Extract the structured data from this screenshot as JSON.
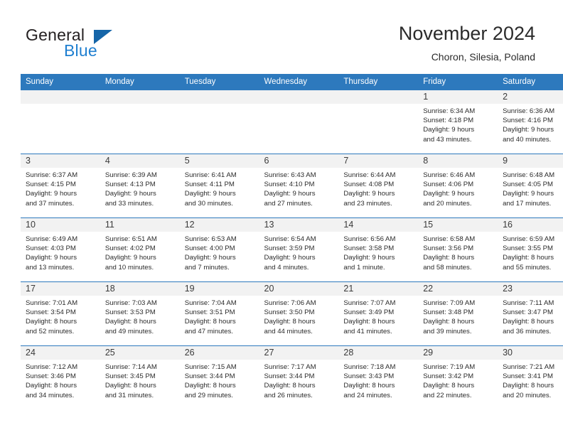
{
  "brand": {
    "name_part1": "General",
    "name_part2": "Blue",
    "triangle_color": "#1565a8",
    "blue_color": "#1f7fd0"
  },
  "header": {
    "month_title": "November 2024",
    "location": "Choron, Silesia, Poland"
  },
  "theme": {
    "header_blue": "#2d79bd",
    "daynum_band": "#f2f2f2",
    "text": "#2b2b2b"
  },
  "weekdays": [
    "Sunday",
    "Monday",
    "Tuesday",
    "Wednesday",
    "Thursday",
    "Friday",
    "Saturday"
  ],
  "weeks": [
    [
      {
        "day": "",
        "sunrise": "",
        "sunset": "",
        "daylight_line1": "",
        "daylight_line2": ""
      },
      {
        "day": "",
        "sunrise": "",
        "sunset": "",
        "daylight_line1": "",
        "daylight_line2": ""
      },
      {
        "day": "",
        "sunrise": "",
        "sunset": "",
        "daylight_line1": "",
        "daylight_line2": ""
      },
      {
        "day": "",
        "sunrise": "",
        "sunset": "",
        "daylight_line1": "",
        "daylight_line2": ""
      },
      {
        "day": "",
        "sunrise": "",
        "sunset": "",
        "daylight_line1": "",
        "daylight_line2": ""
      },
      {
        "day": "1",
        "sunrise": "Sunrise: 6:34 AM",
        "sunset": "Sunset: 4:18 PM",
        "daylight_line1": "Daylight: 9 hours",
        "daylight_line2": "and 43 minutes."
      },
      {
        "day": "2",
        "sunrise": "Sunrise: 6:36 AM",
        "sunset": "Sunset: 4:16 PM",
        "daylight_line1": "Daylight: 9 hours",
        "daylight_line2": "and 40 minutes."
      }
    ],
    [
      {
        "day": "3",
        "sunrise": "Sunrise: 6:37 AM",
        "sunset": "Sunset: 4:15 PM",
        "daylight_line1": "Daylight: 9 hours",
        "daylight_line2": "and 37 minutes."
      },
      {
        "day": "4",
        "sunrise": "Sunrise: 6:39 AM",
        "sunset": "Sunset: 4:13 PM",
        "daylight_line1": "Daylight: 9 hours",
        "daylight_line2": "and 33 minutes."
      },
      {
        "day": "5",
        "sunrise": "Sunrise: 6:41 AM",
        "sunset": "Sunset: 4:11 PM",
        "daylight_line1": "Daylight: 9 hours",
        "daylight_line2": "and 30 minutes."
      },
      {
        "day": "6",
        "sunrise": "Sunrise: 6:43 AM",
        "sunset": "Sunset: 4:10 PM",
        "daylight_line1": "Daylight: 9 hours",
        "daylight_line2": "and 27 minutes."
      },
      {
        "day": "7",
        "sunrise": "Sunrise: 6:44 AM",
        "sunset": "Sunset: 4:08 PM",
        "daylight_line1": "Daylight: 9 hours",
        "daylight_line2": "and 23 minutes."
      },
      {
        "day": "8",
        "sunrise": "Sunrise: 6:46 AM",
        "sunset": "Sunset: 4:06 PM",
        "daylight_line1": "Daylight: 9 hours",
        "daylight_line2": "and 20 minutes."
      },
      {
        "day": "9",
        "sunrise": "Sunrise: 6:48 AM",
        "sunset": "Sunset: 4:05 PM",
        "daylight_line1": "Daylight: 9 hours",
        "daylight_line2": "and 17 minutes."
      }
    ],
    [
      {
        "day": "10",
        "sunrise": "Sunrise: 6:49 AM",
        "sunset": "Sunset: 4:03 PM",
        "daylight_line1": "Daylight: 9 hours",
        "daylight_line2": "and 13 minutes."
      },
      {
        "day": "11",
        "sunrise": "Sunrise: 6:51 AM",
        "sunset": "Sunset: 4:02 PM",
        "daylight_line1": "Daylight: 9 hours",
        "daylight_line2": "and 10 minutes."
      },
      {
        "day": "12",
        "sunrise": "Sunrise: 6:53 AM",
        "sunset": "Sunset: 4:00 PM",
        "daylight_line1": "Daylight: 9 hours",
        "daylight_line2": "and 7 minutes."
      },
      {
        "day": "13",
        "sunrise": "Sunrise: 6:54 AM",
        "sunset": "Sunset: 3:59 PM",
        "daylight_line1": "Daylight: 9 hours",
        "daylight_line2": "and 4 minutes."
      },
      {
        "day": "14",
        "sunrise": "Sunrise: 6:56 AM",
        "sunset": "Sunset: 3:58 PM",
        "daylight_line1": "Daylight: 9 hours",
        "daylight_line2": "and 1 minute."
      },
      {
        "day": "15",
        "sunrise": "Sunrise: 6:58 AM",
        "sunset": "Sunset: 3:56 PM",
        "daylight_line1": "Daylight: 8 hours",
        "daylight_line2": "and 58 minutes."
      },
      {
        "day": "16",
        "sunrise": "Sunrise: 6:59 AM",
        "sunset": "Sunset: 3:55 PM",
        "daylight_line1": "Daylight: 8 hours",
        "daylight_line2": "and 55 minutes."
      }
    ],
    [
      {
        "day": "17",
        "sunrise": "Sunrise: 7:01 AM",
        "sunset": "Sunset: 3:54 PM",
        "daylight_line1": "Daylight: 8 hours",
        "daylight_line2": "and 52 minutes."
      },
      {
        "day": "18",
        "sunrise": "Sunrise: 7:03 AM",
        "sunset": "Sunset: 3:53 PM",
        "daylight_line1": "Daylight: 8 hours",
        "daylight_line2": "and 49 minutes."
      },
      {
        "day": "19",
        "sunrise": "Sunrise: 7:04 AM",
        "sunset": "Sunset: 3:51 PM",
        "daylight_line1": "Daylight: 8 hours",
        "daylight_line2": "and 47 minutes."
      },
      {
        "day": "20",
        "sunrise": "Sunrise: 7:06 AM",
        "sunset": "Sunset: 3:50 PM",
        "daylight_line1": "Daylight: 8 hours",
        "daylight_line2": "and 44 minutes."
      },
      {
        "day": "21",
        "sunrise": "Sunrise: 7:07 AM",
        "sunset": "Sunset: 3:49 PM",
        "daylight_line1": "Daylight: 8 hours",
        "daylight_line2": "and 41 minutes."
      },
      {
        "day": "22",
        "sunrise": "Sunrise: 7:09 AM",
        "sunset": "Sunset: 3:48 PM",
        "daylight_line1": "Daylight: 8 hours",
        "daylight_line2": "and 39 minutes."
      },
      {
        "day": "23",
        "sunrise": "Sunrise: 7:11 AM",
        "sunset": "Sunset: 3:47 PM",
        "daylight_line1": "Daylight: 8 hours",
        "daylight_line2": "and 36 minutes."
      }
    ],
    [
      {
        "day": "24",
        "sunrise": "Sunrise: 7:12 AM",
        "sunset": "Sunset: 3:46 PM",
        "daylight_line1": "Daylight: 8 hours",
        "daylight_line2": "and 34 minutes."
      },
      {
        "day": "25",
        "sunrise": "Sunrise: 7:14 AM",
        "sunset": "Sunset: 3:45 PM",
        "daylight_line1": "Daylight: 8 hours",
        "daylight_line2": "and 31 minutes."
      },
      {
        "day": "26",
        "sunrise": "Sunrise: 7:15 AM",
        "sunset": "Sunset: 3:44 PM",
        "daylight_line1": "Daylight: 8 hours",
        "daylight_line2": "and 29 minutes."
      },
      {
        "day": "27",
        "sunrise": "Sunrise: 7:17 AM",
        "sunset": "Sunset: 3:44 PM",
        "daylight_line1": "Daylight: 8 hours",
        "daylight_line2": "and 26 minutes."
      },
      {
        "day": "28",
        "sunrise": "Sunrise: 7:18 AM",
        "sunset": "Sunset: 3:43 PM",
        "daylight_line1": "Daylight: 8 hours",
        "daylight_line2": "and 24 minutes."
      },
      {
        "day": "29",
        "sunrise": "Sunrise: 7:19 AM",
        "sunset": "Sunset: 3:42 PM",
        "daylight_line1": "Daylight: 8 hours",
        "daylight_line2": "and 22 minutes."
      },
      {
        "day": "30",
        "sunrise": "Sunrise: 7:21 AM",
        "sunset": "Sunset: 3:41 PM",
        "daylight_line1": "Daylight: 8 hours",
        "daylight_line2": "and 20 minutes."
      }
    ]
  ]
}
